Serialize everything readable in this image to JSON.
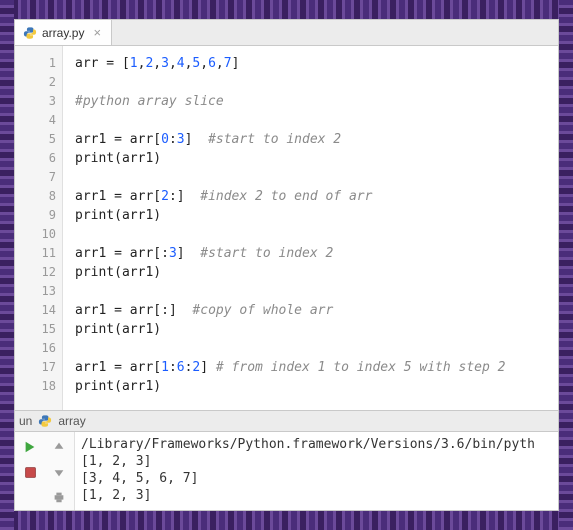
{
  "tab": {
    "filename": "array.py",
    "icon": "python-file-icon",
    "close_glyph": "×"
  },
  "editor": {
    "lines": [
      {
        "n": 1,
        "hl": false,
        "tokens": [
          {
            "t": "var",
            "v": "arr"
          },
          {
            "t": "op",
            "v": " = "
          },
          {
            "t": "brk",
            "v": "["
          },
          {
            "t": "num",
            "v": "1"
          },
          {
            "t": "pun",
            "v": ","
          },
          {
            "t": "num",
            "v": "2"
          },
          {
            "t": "pun",
            "v": ","
          },
          {
            "t": "num",
            "v": "3"
          },
          {
            "t": "pun",
            "v": ","
          },
          {
            "t": "num",
            "v": "4"
          },
          {
            "t": "pun",
            "v": ","
          },
          {
            "t": "num",
            "v": "5"
          },
          {
            "t": "pun",
            "v": ","
          },
          {
            "t": "num",
            "v": "6"
          },
          {
            "t": "pun",
            "v": ","
          },
          {
            "t": "num",
            "v": "7"
          },
          {
            "t": "brk",
            "v": "]"
          }
        ]
      },
      {
        "n": 2,
        "hl": false,
        "tokens": []
      },
      {
        "n": 3,
        "hl": false,
        "tokens": [
          {
            "t": "com",
            "v": "#python array slice"
          }
        ]
      },
      {
        "n": 4,
        "hl": false,
        "tokens": []
      },
      {
        "n": 5,
        "hl": false,
        "tokens": [
          {
            "t": "var",
            "v": "arr1"
          },
          {
            "t": "op",
            "v": " = "
          },
          {
            "t": "var",
            "v": "arr"
          },
          {
            "t": "brk",
            "v": "["
          },
          {
            "t": "num",
            "v": "0"
          },
          {
            "t": "pun",
            "v": ":"
          },
          {
            "t": "num",
            "v": "3"
          },
          {
            "t": "brk",
            "v": "]"
          },
          {
            "t": "var",
            "v": "  "
          },
          {
            "t": "com",
            "v": "#start to index 2"
          }
        ]
      },
      {
        "n": 6,
        "hl": false,
        "tokens": [
          {
            "t": "fn",
            "v": "print"
          },
          {
            "t": "brk",
            "v": "("
          },
          {
            "t": "var",
            "v": "arr1"
          },
          {
            "t": "brk",
            "v": ")"
          }
        ]
      },
      {
        "n": 7,
        "hl": false,
        "tokens": []
      },
      {
        "n": 8,
        "hl": false,
        "tokens": [
          {
            "t": "var",
            "v": "arr1"
          },
          {
            "t": "op",
            "v": " = "
          },
          {
            "t": "var",
            "v": "arr"
          },
          {
            "t": "brk",
            "v": "["
          },
          {
            "t": "num",
            "v": "2"
          },
          {
            "t": "pun",
            "v": ":"
          },
          {
            "t": "brk",
            "v": "]"
          },
          {
            "t": "var",
            "v": "  "
          },
          {
            "t": "com",
            "v": "#index 2 to end of arr"
          }
        ]
      },
      {
        "n": 9,
        "hl": false,
        "tokens": [
          {
            "t": "fn",
            "v": "print"
          },
          {
            "t": "brk",
            "v": "("
          },
          {
            "t": "var",
            "v": "arr1"
          },
          {
            "t": "brk",
            "v": ")"
          }
        ]
      },
      {
        "n": 10,
        "hl": false,
        "tokens": []
      },
      {
        "n": 11,
        "hl": false,
        "tokens": [
          {
            "t": "var",
            "v": "arr1"
          },
          {
            "t": "op",
            "v": " = "
          },
          {
            "t": "var",
            "v": "arr"
          },
          {
            "t": "brk",
            "v": "["
          },
          {
            "t": "pun",
            "v": ":"
          },
          {
            "t": "num",
            "v": "3"
          },
          {
            "t": "brk",
            "v": "]"
          },
          {
            "t": "var",
            "v": "  "
          },
          {
            "t": "com",
            "v": "#start to index 2"
          }
        ]
      },
      {
        "n": 12,
        "hl": false,
        "tokens": [
          {
            "t": "fn",
            "v": "print"
          },
          {
            "t": "brk",
            "v": "("
          },
          {
            "t": "var",
            "v": "arr1"
          },
          {
            "t": "brk",
            "v": ")"
          }
        ]
      },
      {
        "n": 13,
        "hl": false,
        "tokens": []
      },
      {
        "n": 14,
        "hl": false,
        "tokens": [
          {
            "t": "var",
            "v": "arr1"
          },
          {
            "t": "op",
            "v": " = "
          },
          {
            "t": "var",
            "v": "arr"
          },
          {
            "t": "brk",
            "v": "["
          },
          {
            "t": "pun",
            "v": ":"
          },
          {
            "t": "brk",
            "v": "]"
          },
          {
            "t": "var",
            "v": "  "
          },
          {
            "t": "com",
            "v": "#copy of whole arr"
          }
        ]
      },
      {
        "n": 15,
        "hl": false,
        "tokens": [
          {
            "t": "fn",
            "v": "print"
          },
          {
            "t": "brk",
            "v": "("
          },
          {
            "t": "var",
            "v": "arr1"
          },
          {
            "t": "brk",
            "v": ")"
          }
        ]
      },
      {
        "n": 16,
        "hl": false,
        "tokens": []
      },
      {
        "n": 17,
        "hl": true,
        "tokens": [
          {
            "t": "var",
            "v": "arr1"
          },
          {
            "t": "op",
            "v": " = "
          },
          {
            "t": "var",
            "v": "arr"
          },
          {
            "t": "brk",
            "v": "["
          },
          {
            "t": "num",
            "v": "1"
          },
          {
            "t": "pun",
            "v": ":"
          },
          {
            "t": "num",
            "v": "6"
          },
          {
            "t": "pun",
            "v": ":"
          },
          {
            "t": "num",
            "v": "2"
          },
          {
            "t": "brk",
            "v": "]"
          },
          {
            "t": "var",
            "v": " "
          },
          {
            "t": "com",
            "v": "# from index 1 to index 5 with step 2"
          }
        ]
      },
      {
        "n": 18,
        "hl": false,
        "tokens": [
          {
            "t": "fn",
            "v": "print"
          },
          {
            "t": "brk",
            "v": "("
          },
          {
            "t": "var",
            "v": "arr1"
          },
          {
            "t": "brk",
            "v": ")"
          }
        ]
      }
    ]
  },
  "run": {
    "header_prefix": "un",
    "header_name": "array"
  },
  "console": {
    "lines": [
      "/Library/Frameworks/Python.framework/Versions/3.6/bin/pyth",
      "[1, 2, 3]",
      "[3, 4, 5, 6, 7]",
      "[1, 2, 3]"
    ]
  }
}
